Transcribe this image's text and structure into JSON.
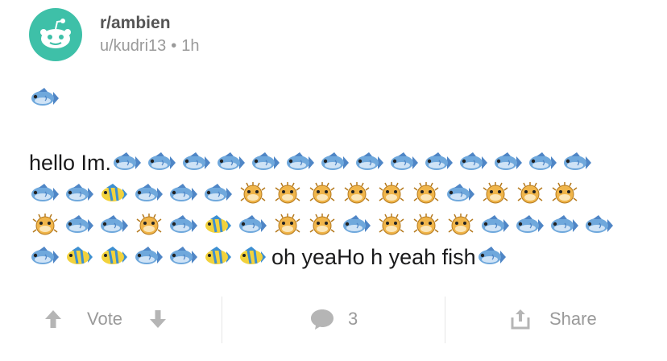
{
  "post": {
    "subreddit": "r/ambien",
    "username": "u/kudri13",
    "separator": "•",
    "time": "1h",
    "text_start": "hello Im.",
    "text_middle": "oh yeaHo h yeah fish",
    "emoji_line1": [
      "fish"
    ],
    "emoji_row1": [
      "fish",
      "fish",
      "fish",
      "fish",
      "fish",
      "fish",
      "fish",
      "fish",
      "fish",
      "fish",
      "fish",
      "fish",
      "fish",
      "fish"
    ],
    "emoji_row2": [
      "fish",
      "fish",
      "tropical-fish",
      "fish",
      "fish",
      "fish",
      "blowfish",
      "blowfish",
      "blowfish",
      "blowfish",
      "blowfish",
      "blowfish",
      "fish",
      "blowfish",
      "blowfish",
      "blowfish"
    ],
    "emoji_row3": [
      "blowfish",
      "fish",
      "fish",
      "blowfish",
      "fish",
      "tropical-fish",
      "fish",
      "blowfish",
      "blowfish",
      "fish",
      "blowfish",
      "blowfish",
      "blowfish",
      "fish",
      "fish",
      "fish",
      "fish"
    ],
    "emoji_row4_before": [
      "fish",
      "tropical-fish",
      "tropical-fish",
      "fish",
      "fish",
      "tropical-fish",
      "tropical-fish"
    ],
    "emoji_row4_after": [
      "fish"
    ]
  },
  "footer": {
    "vote_label": "Vote",
    "comment_count": "3",
    "share_label": "Share"
  },
  "colors": {
    "avatar_bg": "#3ec0a8",
    "muted_text": "#9a9a9a",
    "fish_body": "#6fa8dc",
    "blowfish_body": "#f0b54a",
    "tropical_body": "#f2d23c"
  }
}
